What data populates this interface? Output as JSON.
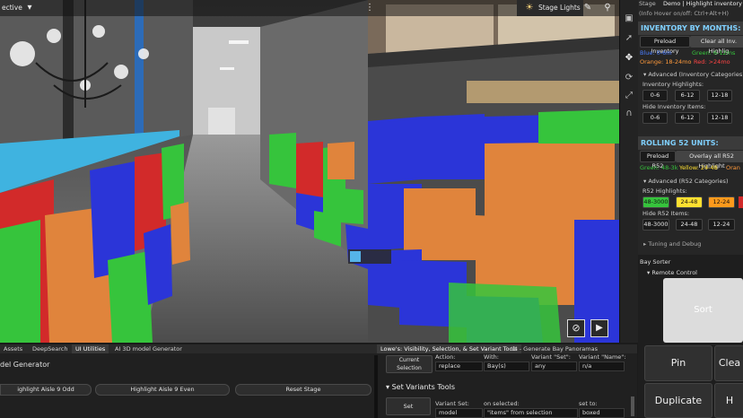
{
  "viewport": {
    "perspective_label": "ective",
    "stage_lights_label": "Stage Lights"
  },
  "colors": {
    "panel_header_text": "#7fd0ff",
    "highlight_blue": "#2b35d8",
    "highlight_orange": "#e0843c",
    "highlight_green": "#36c43c",
    "highlight_red": "#d22a2a",
    "highlight_yellow": "#ffe030"
  },
  "right_panel": {
    "stage_label": "Stage",
    "stage_title": "Demo | Highlight inventory Ex",
    "hover_hint": "(Info Hover on/off: Ctrl+Alt+H)",
    "inventory": {
      "header": "INVENTORY BY MONTHS:",
      "preload_btn": "Preload Inventory",
      "clear_btn": "Clear all Inv. Highlig",
      "legend_blue": "Blue: 0-6m",
      "legend_green": "Green: 6-12ms",
      "legend_orange": "Orange: 18-24mo",
      "legend_red": "Red: >24mo",
      "advanced": "Advanced (Inventory Categories)",
      "highlights_label": "Inventory Highlights:",
      "highlights": [
        "0-6",
        "6-12",
        "12-18"
      ],
      "hide_label": "Hide Inventory Items:",
      "hide": [
        "0-6",
        "6-12",
        "12-18"
      ]
    },
    "rolling": {
      "header": "ROLLING 52 UNITS:",
      "preload_btn": "Preload R52",
      "overlay_btn": "Overlay all R52 Highlight",
      "legend_green": "Green: 48-3k",
      "legend_yellow": "Yellow: 24-48",
      "legend_orange": "Oran",
      "advanced": "Advanced (R52 Categories)",
      "highlights_label": "R52 Highlights:",
      "highlights": [
        "48-3000",
        "24-48",
        "12-24"
      ],
      "hide_label": "Hide R52 Items:",
      "hide": [
        "48-3000",
        "24-48",
        "12-24"
      ]
    },
    "tuning": "Tuning and Debug"
  },
  "bay_sorter": {
    "title": "Bay Sorter",
    "remote_label": "Remote Control",
    "sort_label": "Sort",
    "pin_label": "Pin",
    "clear_label": "Clea",
    "duplicate_label": "Duplicate",
    "h_label": "H"
  },
  "bottom": {
    "tabs": [
      "Assets",
      "DeepSearch",
      "UI Utilities",
      "AI 3D model Generator"
    ],
    "right_tabs": [
      "Lowe's: Visibility, Selection, & Set Variant Tools",
      "UI - Generate Bay Panoramas"
    ],
    "model_generator_title": "del Generator",
    "btn_aisle_odd": "ighlight Aisle 9 Odd",
    "btn_aisle_even": "Highlight Aisle 9 Even",
    "btn_reset": "Reset Stage",
    "current_selection": "Current Selection",
    "action_label": "Action:",
    "action_value": "replace",
    "with_label": "With:",
    "with_value": "Bay(s)",
    "variant_set_label": "Variant \"Set\":",
    "variant_set_value": "any",
    "variant_name_label": "Variant \"Name\":",
    "variant_name_value": "n/a",
    "set_variants_title": "Set Variants Tools",
    "set_btn": "Set",
    "vs_label": "Variant Set:",
    "vs_value": "model",
    "on_selected_label": "on selected:",
    "on_selected_value": "\"items\" from selection",
    "set_to_label": "set to:",
    "set_to_value": "boxed"
  }
}
